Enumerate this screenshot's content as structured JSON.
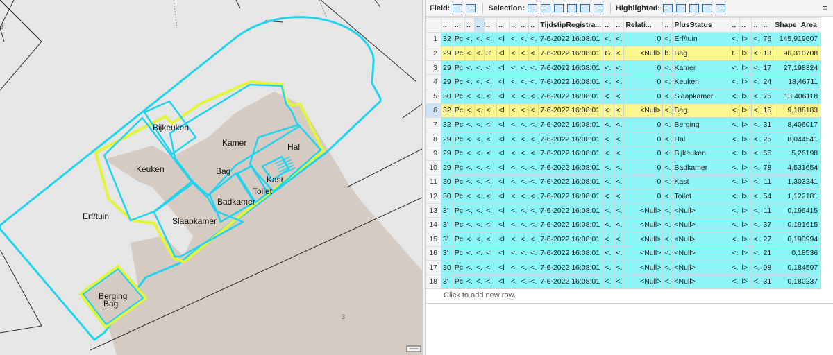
{
  "map": {
    "labels": {
      "bijkeuken": "Bijkeuken",
      "kamer": "Kamer",
      "hal": "Hal",
      "keuken": "Keuken",
      "bag": "Bag",
      "kast": "Kast",
      "toilet": "Toilet",
      "badkamer": "Badkamer",
      "slaapkamer": "Slaapkamer",
      "erf_tuin": "Erf/tuin",
      "berging": "Berging",
      "berging_bag": "Bag",
      "parcel_3": "3",
      "edge_8": "8"
    },
    "colors": {
      "selection": "#22d3f0",
      "highlight": "#e4f538",
      "building": "#d5cbc3",
      "ground": "#e6e6e6"
    }
  },
  "toolbar": {
    "field_label": "Field:",
    "selection_label": "Selection:",
    "highlighted_label": "Highlighted:",
    "field_icons": [
      "add-field-icon",
      "calculate-field-icon"
    ],
    "selection_icons": [
      "select-by-attributes-icon",
      "zoom-to-selection-icon",
      "switch-selection-icon",
      "clear-selection-icon",
      "delete-selection-icon",
      "copy-selection-icon"
    ],
    "highlighted_icons": [
      "zoom-to-highlighted-icon",
      "switch-highlighted-icon",
      "clear-highlighted-icon",
      "delete-highlighted-icon",
      "copy-highlighted-icon"
    ],
    "menu_icon": "≡"
  },
  "table": {
    "headers": [
      "..",
      "..",
      "..",
      "..",
      "..",
      "..",
      "..",
      "..",
      "..",
      "TijdstipRegistra...",
      "..",
      "..",
      "Relati...",
      "..",
      "PlusStatus",
      "..",
      "..",
      "..",
      "..",
      "Shape_Area"
    ],
    "rows": [
      {
        "n": "1",
        "state": "sel",
        "cells": [
          "32",
          "Pc",
          "<.",
          "<.",
          "<l",
          "<l",
          "<.",
          "<.",
          "<.",
          "7-6-2022 16:08:01",
          "<.",
          "<.",
          "0",
          "<.",
          "Erf/tuin",
          "<.",
          "l>",
          "<.",
          "76",
          "145,919607"
        ]
      },
      {
        "n": "2",
        "state": "hl",
        "cells": [
          "29",
          "Pc",
          "<.",
          "<.",
          "3'",
          "<l",
          "<.",
          "<.",
          "<.",
          "7-6-2022 16:08:01",
          "G.",
          "<.",
          "<Null>",
          "b.",
          "Bag",
          "t..",
          "l>",
          "<.",
          "13",
          "96,310708"
        ]
      },
      {
        "n": "3",
        "state": "sel",
        "cells": [
          "29",
          "Pc",
          "<.",
          "<.",
          "<l",
          "<l",
          "<.",
          "<.",
          "<.",
          "7-6-2022 16:08:01",
          "<.",
          "<.",
          "0",
          "<.",
          "Kamer",
          "<.",
          "l>",
          "<.",
          "17",
          "27,198324"
        ]
      },
      {
        "n": "4",
        "state": "sel",
        "cells": [
          "29",
          "Pc",
          "<.",
          "<.",
          "<l",
          "<l",
          "<.",
          "<.",
          "<.",
          "7-6-2022 16:08:01",
          "<.",
          "<.",
          "0",
          "<.",
          "Keuken",
          "<.",
          "l>",
          "<.",
          "24",
          "18,46711"
        ]
      },
      {
        "n": "5",
        "state": "sel",
        "cells": [
          "30",
          "Pc",
          "<.",
          "<.",
          "<l",
          "<l",
          "<.",
          "<.",
          "<.",
          "7-6-2022 16:08:01",
          "<.",
          "<.",
          "0",
          "<.",
          "Slaapkamer",
          "<.",
          "l>",
          "<.",
          "75",
          "13,406118"
        ]
      },
      {
        "n": "6",
        "state": "hl",
        "cells": [
          "32",
          "Pc",
          "<.",
          "<.",
          "<l",
          "<l",
          "<.",
          "<.",
          "<.",
          "7-6-2022 16:08:01",
          "<.",
          "<.",
          "<Null>",
          "<.",
          "Bag",
          "<.",
          "l>",
          "<.",
          "15",
          "9,188183"
        ]
      },
      {
        "n": "7",
        "state": "sel",
        "cells": [
          "32",
          "Pc",
          "<.",
          "<.",
          "<l",
          "<l",
          "<.",
          "<.",
          "<.",
          "7-6-2022 16:08:01",
          "<.",
          "<.",
          "0",
          "<.",
          "Berging",
          "<.",
          "l>",
          "<.",
          "31",
          "8,406017"
        ]
      },
      {
        "n": "8",
        "state": "sel",
        "cells": [
          "29",
          "Pc",
          "<.",
          "<.",
          "<l",
          "<l",
          "<.",
          "<.",
          "<.",
          "7-6-2022 16:08:01",
          "<.",
          "<.",
          "0",
          "<.",
          "Hal",
          "<.",
          "l>",
          "<.",
          "25",
          "8,044541"
        ]
      },
      {
        "n": "9",
        "state": "sel",
        "cells": [
          "29",
          "Pc",
          "<.",
          "<.",
          "<l",
          "<l",
          "<.",
          "<.",
          "<.",
          "7-6-2022 16:08:01",
          "<.",
          "<.",
          "0",
          "<.",
          "Bijkeuken",
          "<.",
          "l>",
          "<.",
          "55",
          "5,26198"
        ]
      },
      {
        "n": "10",
        "state": "sel",
        "cells": [
          "29",
          "Pc",
          "<.",
          "<.",
          "<l",
          "<l",
          "<.",
          "<.",
          "<.",
          "7-6-2022 16:08:01",
          "<.",
          "<.",
          "0",
          "<.",
          "Badkamer",
          "<.",
          "l>",
          "<.",
          "78",
          "4,531654"
        ]
      },
      {
        "n": "11",
        "state": "sel",
        "cells": [
          "30",
          "Pc",
          "<.",
          "<.",
          "<l",
          "<l",
          "<.",
          "<.",
          "<.",
          "7-6-2022 16:08:01",
          "<.",
          "<.",
          "0",
          "<.",
          "Kast",
          "<.",
          "l>",
          "<.",
          "11",
          "1,303241"
        ]
      },
      {
        "n": "12",
        "state": "sel",
        "cells": [
          "30",
          "Pc",
          "<.",
          "<.",
          "<l",
          "<l",
          "<.",
          "<.",
          "<.",
          "7-6-2022 16:08:01",
          "<.",
          "<.",
          "0",
          "<.",
          "Toilet",
          "<.",
          "l>",
          "<.",
          "54",
          "1,122181"
        ]
      },
      {
        "n": "13",
        "state": "sel",
        "cells": [
          "3'",
          "Pc",
          "<.",
          "<.",
          "<l",
          "<l",
          "<.",
          "<.",
          "<.",
          "7-6-2022 16:08:01",
          "<.",
          "<.",
          "<Null>",
          "<.",
          "<Null>",
          "<.",
          "l>",
          "<.",
          "11",
          "0,196415"
        ]
      },
      {
        "n": "14",
        "state": "sel",
        "cells": [
          "3'",
          "Pc",
          "<.",
          "<.",
          "<l",
          "<l",
          "<.",
          "<.",
          "<.",
          "7-6-2022 16:08:01",
          "<.",
          "<.",
          "<Null>",
          "<.",
          "<Null>",
          "<.",
          "l>",
          "<.",
          "37",
          "0,191615"
        ]
      },
      {
        "n": "15",
        "state": "sel",
        "cells": [
          "3'",
          "Pc",
          "<.",
          "<.",
          "<l",
          "<l",
          "<.",
          "<.",
          "<.",
          "7-6-2022 16:08:01",
          "<.",
          "<.",
          "<Null>",
          "<.",
          "<Null>",
          "<.",
          "l>",
          "<.",
          "27",
          "0,190994"
        ]
      },
      {
        "n": "16",
        "state": "sel",
        "cells": [
          "3'",
          "Pc",
          "<.",
          "<.",
          "<l",
          "<l",
          "<.",
          "<.",
          "<.",
          "7-6-2022 16:08:01",
          "<.",
          "<.",
          "<Null>",
          "<.",
          "<Null>",
          "<.",
          "l>",
          "<.",
          "21",
          "0,18536"
        ]
      },
      {
        "n": "17",
        "state": "sel",
        "cells": [
          "30",
          "Pc",
          "<.",
          "<.",
          "<l",
          "<l",
          "<.",
          "<.",
          "<.",
          "7-6-2022 16:08:01",
          "<.",
          "<.",
          "<Null>",
          "<.",
          "<Null>",
          "<.",
          "l>",
          "<.",
          "98",
          "0,184597"
        ]
      },
      {
        "n": "18",
        "state": "sel",
        "cells": [
          "3'",
          "Pc",
          "<.",
          "<.",
          "<l",
          "<l",
          "<.",
          "<.",
          "<.",
          "7-6-2022 16:08:01",
          "<.",
          "<.",
          "<Null>",
          "<.",
          "<Null>",
          "<.",
          "l>",
          "<.",
          "31",
          "0,180237"
        ]
      }
    ],
    "add_row_text": "Click to add new row.",
    "active_row": "6"
  }
}
